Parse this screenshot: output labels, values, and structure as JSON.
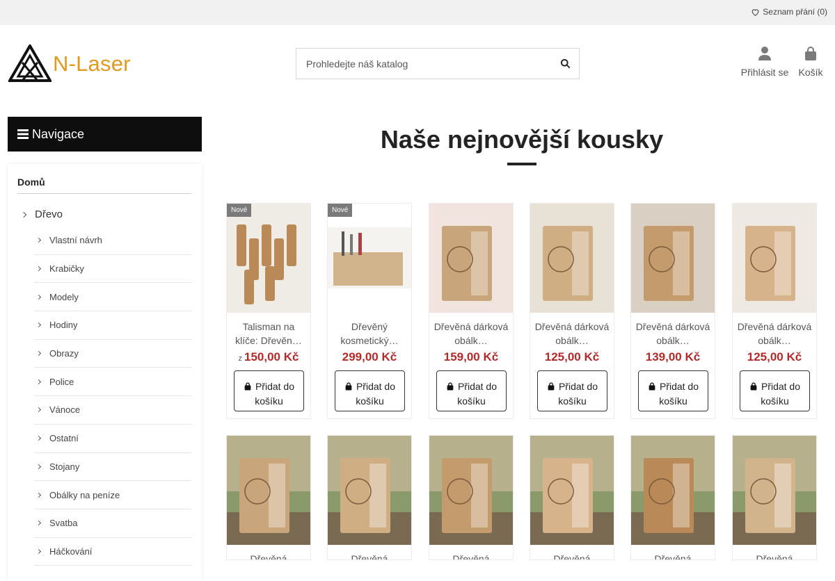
{
  "topbar": {
    "wishlist_label": "Seznam přání (0)"
  },
  "header": {
    "logo_text": "N-Laser",
    "search_placeholder": "Prohledejte náš katalog",
    "login_label": "Přihlásit se",
    "cart_label": "Košík"
  },
  "sidebar": {
    "nav_title": "Navigace",
    "home_label": "Domů",
    "category": "Dřevo",
    "items": [
      "Vlastní návrh",
      "Krabičky",
      "Modely",
      "Hodiny",
      "Obrazy",
      "Police",
      "Vánoce",
      "Ostatní",
      "Stojany",
      "Obálky na peníze",
      "Svatba",
      "Háčkování"
    ]
  },
  "main": {
    "title": "Naše nejnovější kousky"
  },
  "products": [
    {
      "badge": "Nové",
      "name": "Talisman na klíče: Dřevěn…",
      "price_prefix": "z",
      "price": "150,00 Kč",
      "button": "Přidat do košíku"
    },
    {
      "badge": "Nové",
      "name": "Dřevěný kosmetický…",
      "price_prefix": "",
      "price": "299,00 Kč",
      "button": "Přidat do košíku"
    },
    {
      "badge": "",
      "name": "Dřevěná dárková obálk…",
      "price_prefix": "",
      "price": "159,00 Kč",
      "button": "Přidat do košíku"
    },
    {
      "badge": "",
      "name": "Dřevěná dárková obálk…",
      "price_prefix": "",
      "price": "125,00 Kč",
      "button": "Přidat do košíku"
    },
    {
      "badge": "",
      "name": "Dřevěná dárková obálk…",
      "price_prefix": "",
      "price": "139,00 Kč",
      "button": "Přidat do košíku"
    },
    {
      "badge": "",
      "name": "Dřevěná dárková obálk…",
      "price_prefix": "",
      "price": "125,00 Kč",
      "button": "Přidat do košíku"
    }
  ],
  "products_row2": [
    {
      "name": "Dřevěná"
    },
    {
      "name": "Dřevěná"
    },
    {
      "name": "Dřevěná"
    },
    {
      "name": "Dřevěná"
    },
    {
      "name": "Dřevěná"
    },
    {
      "name": "Dřevěná"
    }
  ],
  "colors": {
    "accent": "#e09a1f",
    "price": "#b02a2a",
    "nav_bg": "#0e0e0e"
  }
}
